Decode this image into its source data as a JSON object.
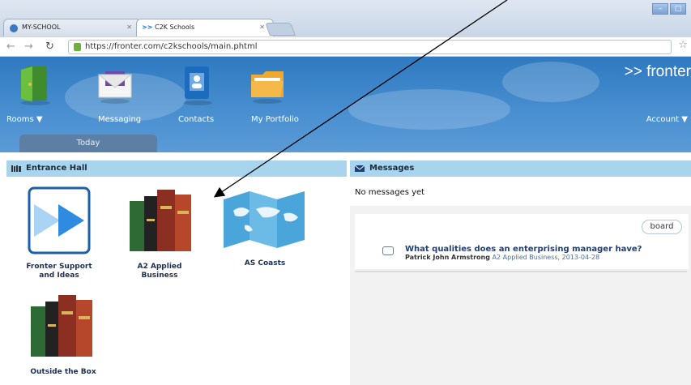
{
  "browser": {
    "tabs": [
      {
        "label": "MY-SCHOOL"
      },
      {
        "label": "C2K Schools"
      }
    ],
    "url": "https://fronter.com/c2kschools/main.phtml",
    "window_buttons": [
      "–",
      "□"
    ]
  },
  "app": {
    "brand": ">> fronter",
    "nav": [
      {
        "label": "Rooms",
        "icon": "door-icon"
      },
      {
        "label": "Messaging",
        "icon": "envelope-icon"
      },
      {
        "label": "Contacts",
        "icon": "address-book-icon"
      },
      {
        "label": "My Portfolio",
        "icon": "folder-icon"
      }
    ],
    "account": "Account",
    "today_tab": "Today"
  },
  "entrance_hall": {
    "title": "Entrance Hall",
    "rooms": [
      {
        "line1": "Fronter Support",
        "line2": "and Ideas",
        "icon": "fronter-logo-icon"
      },
      {
        "line1": "A2 Applied",
        "line2": "Business",
        "icon": "books-icon"
      },
      {
        "line1": "AS Coasts",
        "line2": "",
        "icon": "map-icon"
      },
      {
        "line1": "Outside the Box",
        "line2": "",
        "icon": "books-icon"
      }
    ]
  },
  "messages": {
    "title": "Messages",
    "empty": "No messages yet",
    "dashboard_button": "board",
    "post": {
      "title": "What qualities does an enterprising manager have?",
      "author": "Patrick John Armstrong",
      "context": "A2 Applied Business, 2013-04-28"
    }
  }
}
